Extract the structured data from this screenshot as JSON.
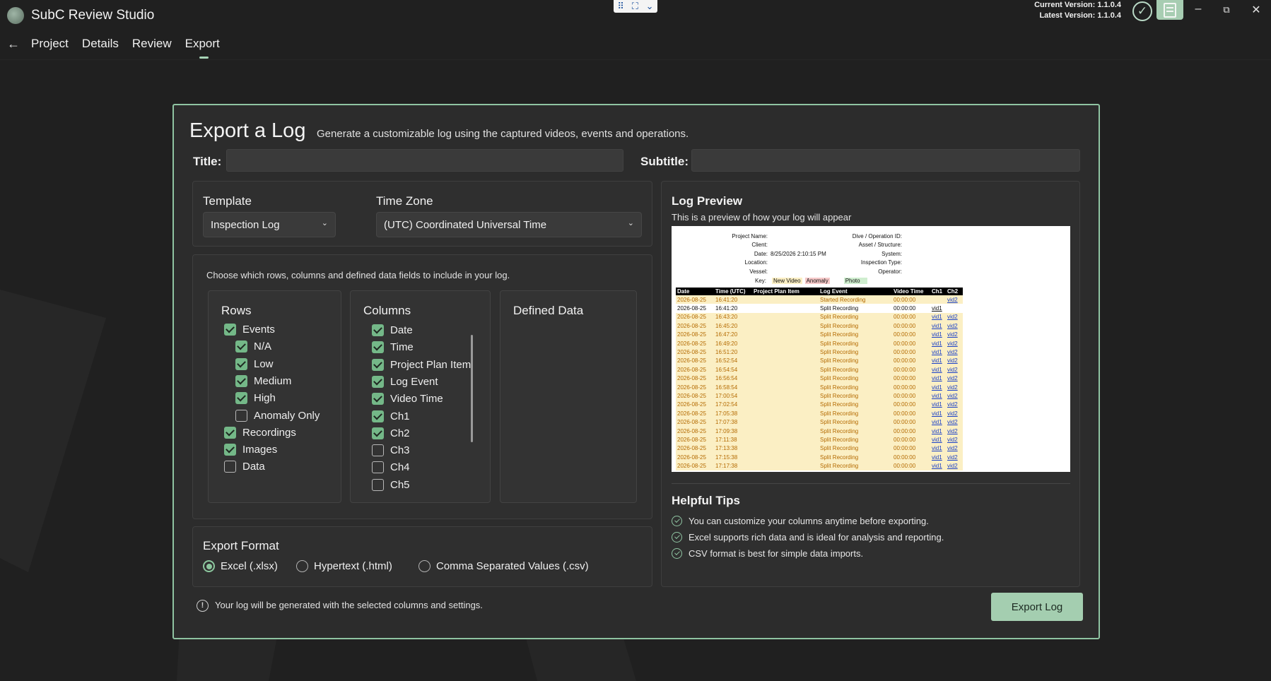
{
  "app": {
    "title": "SubC Review Studio",
    "current_version": "Current Version: 1.1.0.4",
    "latest_version": "Latest Version: 1.1.0.4"
  },
  "window_controls": {
    "minimize": "–",
    "restore": "⧉",
    "close": "✕"
  },
  "nav": {
    "back": "←",
    "tabs": [
      {
        "label": "Project"
      },
      {
        "label": "Details"
      },
      {
        "label": "Review"
      },
      {
        "label": "Export"
      }
    ],
    "active": "Export"
  },
  "export": {
    "title": "Export a Log",
    "description": "Generate a customizable log using the captured videos, events and operations.",
    "title_label": "Title:",
    "title_value": "",
    "subtitle_label": "Subtitle:",
    "subtitle_value": "",
    "template_label": "Template",
    "template_value": "Inspection Log",
    "timezone_label": "Time Zone",
    "timezone_value": "(UTC) Coordinated Universal Time",
    "choose_text": "Choose which rows, columns and defined data fields to include in your log.",
    "rows_heading": "Rows",
    "rows": [
      {
        "label": "Events",
        "checked": true,
        "indent": false
      },
      {
        "label": "N/A",
        "checked": true,
        "indent": true
      },
      {
        "label": "Low",
        "checked": true,
        "indent": true
      },
      {
        "label": "Medium",
        "checked": true,
        "indent": true
      },
      {
        "label": "High",
        "checked": true,
        "indent": true
      },
      {
        "label": "Anomaly Only",
        "checked": false,
        "indent": true
      },
      {
        "label": "Recordings",
        "checked": true,
        "indent": false
      },
      {
        "label": "Images",
        "checked": true,
        "indent": false
      },
      {
        "label": "Data",
        "checked": false,
        "indent": false
      }
    ],
    "columns_heading": "Columns",
    "columns": [
      {
        "label": "Date",
        "checked": true
      },
      {
        "label": "Time",
        "checked": true
      },
      {
        "label": "Project Plan Item",
        "checked": true
      },
      {
        "label": "Log Event",
        "checked": true
      },
      {
        "label": "Video Time",
        "checked": true
      },
      {
        "label": "Ch1",
        "checked": true
      },
      {
        "label": "Ch2",
        "checked": true
      },
      {
        "label": "Ch3",
        "checked": false
      },
      {
        "label": "Ch4",
        "checked": false
      },
      {
        "label": "Ch5",
        "checked": false
      }
    ],
    "defined_data_heading": "Defined Data",
    "format_heading": "Export Format",
    "formats": [
      {
        "label": "Excel (.xlsx)",
        "selected": true
      },
      {
        "label": "Hypertext (.html)",
        "selected": false
      },
      {
        "label": "Comma Separated Values (.csv)",
        "selected": false
      }
    ],
    "info_text": "Your log will be generated with the selected columns and settings.",
    "export_button": "Export Log"
  },
  "preview": {
    "heading": "Log Preview",
    "subtext": "This is a preview of how your log will appear",
    "meta_left": [
      {
        "label": "Project Name:",
        "value": ""
      },
      {
        "label": "Client:",
        "value": ""
      },
      {
        "label": "Date:",
        "value": "8/25/2026 2:10:15 PM"
      },
      {
        "label": "Location:",
        "value": ""
      },
      {
        "label": "Vessel:",
        "value": ""
      }
    ],
    "meta_right": [
      "Dive / Operation ID:",
      "Asset / Structure:",
      "System:",
      "Inspection Type:",
      "Operator:"
    ],
    "key_label": "Key:",
    "key_items": [
      {
        "label": "New Video",
        "color": "#fbefc4"
      },
      {
        "label": "Anomaly",
        "color": "#f6c9c9"
      },
      {
        "label": "Photo",
        "color": "#cfeecf"
      }
    ],
    "table_headers": [
      "Date",
      "Time (UTC)",
      "Project Plan Item",
      "Log Event",
      "Video Time",
      "Ch1",
      "Ch2"
    ],
    "table_rows": [
      {
        "date": "2026-08-25",
        "time": "16:41:20",
        "plan": "",
        "event": "Started Recording",
        "vtime": "00:00:00",
        "ch1": "",
        "ch2": "vid2",
        "style": "y"
      },
      {
        "date": "2026-08-25",
        "time": "16:41:20",
        "plan": "",
        "event": "Split Recording",
        "vtime": "00:00:00",
        "ch1": "vid1",
        "ch2": "",
        "style": "w"
      },
      {
        "date": "2026-08-25",
        "time": "16:43:20",
        "plan": "",
        "event": "Split Recording",
        "vtime": "00:00:00",
        "ch1": "vid1",
        "ch2": "vid2",
        "style": "y"
      },
      {
        "date": "2026-08-25",
        "time": "16:45:20",
        "plan": "",
        "event": "Split Recording",
        "vtime": "00:00:00",
        "ch1": "vid1",
        "ch2": "vid2",
        "style": "y"
      },
      {
        "date": "2026-08-25",
        "time": "16:47:20",
        "plan": "",
        "event": "Split Recording",
        "vtime": "00:00:00",
        "ch1": "vid1",
        "ch2": "vid2",
        "style": "y"
      },
      {
        "date": "2026-08-25",
        "time": "16:49:20",
        "plan": "",
        "event": "Split Recording",
        "vtime": "00:00:00",
        "ch1": "vid1",
        "ch2": "vid2",
        "style": "y"
      },
      {
        "date": "2026-08-25",
        "time": "16:51:20",
        "plan": "",
        "event": "Split Recording",
        "vtime": "00:00:00",
        "ch1": "vid1",
        "ch2": "vid2",
        "style": "y"
      },
      {
        "date": "2026-08-25",
        "time": "16:52:54",
        "plan": "",
        "event": "Split Recording",
        "vtime": "00:00:00",
        "ch1": "vid1",
        "ch2": "vid2",
        "style": "y"
      },
      {
        "date": "2026-08-25",
        "time": "16:54:54",
        "plan": "",
        "event": "Split Recording",
        "vtime": "00:00:00",
        "ch1": "vid1",
        "ch2": "vid2",
        "style": "y"
      },
      {
        "date": "2026-08-25",
        "time": "16:56:54",
        "plan": "",
        "event": "Split Recording",
        "vtime": "00:00:00",
        "ch1": "vid1",
        "ch2": "vid2",
        "style": "y"
      },
      {
        "date": "2026-08-25",
        "time": "16:58:54",
        "plan": "",
        "event": "Split Recording",
        "vtime": "00:00:00",
        "ch1": "vid1",
        "ch2": "vid2",
        "style": "y"
      },
      {
        "date": "2026-08-25",
        "time": "17:00:54",
        "plan": "",
        "event": "Split Recording",
        "vtime": "00:00:00",
        "ch1": "vid1",
        "ch2": "vid2",
        "style": "y"
      },
      {
        "date": "2026-08-25",
        "time": "17:02:54",
        "plan": "",
        "event": "Split Recording",
        "vtime": "00:00:00",
        "ch1": "vid1",
        "ch2": "vid2",
        "style": "y"
      },
      {
        "date": "2026-08-25",
        "time": "17:05:38",
        "plan": "",
        "event": "Split Recording",
        "vtime": "00:00:00",
        "ch1": "vid1",
        "ch2": "vid2",
        "style": "y"
      },
      {
        "date": "2026-08-25",
        "time": "17:07:38",
        "plan": "",
        "event": "Split Recording",
        "vtime": "00:00:00",
        "ch1": "vid1",
        "ch2": "vid2",
        "style": "y"
      },
      {
        "date": "2026-08-25",
        "time": "17:09:38",
        "plan": "",
        "event": "Split Recording",
        "vtime": "00:00:00",
        "ch1": "vid1",
        "ch2": "vid2",
        "style": "y"
      },
      {
        "date": "2026-08-25",
        "time": "17:11:38",
        "plan": "",
        "event": "Split Recording",
        "vtime": "00:00:00",
        "ch1": "vid1",
        "ch2": "vid2",
        "style": "y"
      },
      {
        "date": "2026-08-25",
        "time": "17:13:38",
        "plan": "",
        "event": "Split Recording",
        "vtime": "00:00:00",
        "ch1": "vid1",
        "ch2": "vid2",
        "style": "y"
      },
      {
        "date": "2026-08-25",
        "time": "17:15:38",
        "plan": "",
        "event": "Split Recording",
        "vtime": "00:00:00",
        "ch1": "vid1",
        "ch2": "vid2",
        "style": "y"
      },
      {
        "date": "2026-08-25",
        "time": "17:17:38",
        "plan": "",
        "event": "Split Recording",
        "vtime": "00:00:00",
        "ch1": "vid1",
        "ch2": "vid2",
        "style": "y"
      }
    ]
  },
  "tips": {
    "heading": "Helpful Tips",
    "items": [
      "You can customize your columns anytime before exporting.",
      "Excel supports rich data and is ideal for analysis and reporting.",
      "CSV format is best for simple data imports."
    ]
  },
  "colors": {
    "accent": "#8fc4a2",
    "checkbox": "#74b888",
    "button": "#a4ceb0",
    "background": "#202020",
    "panel": "#2c2c2c"
  }
}
